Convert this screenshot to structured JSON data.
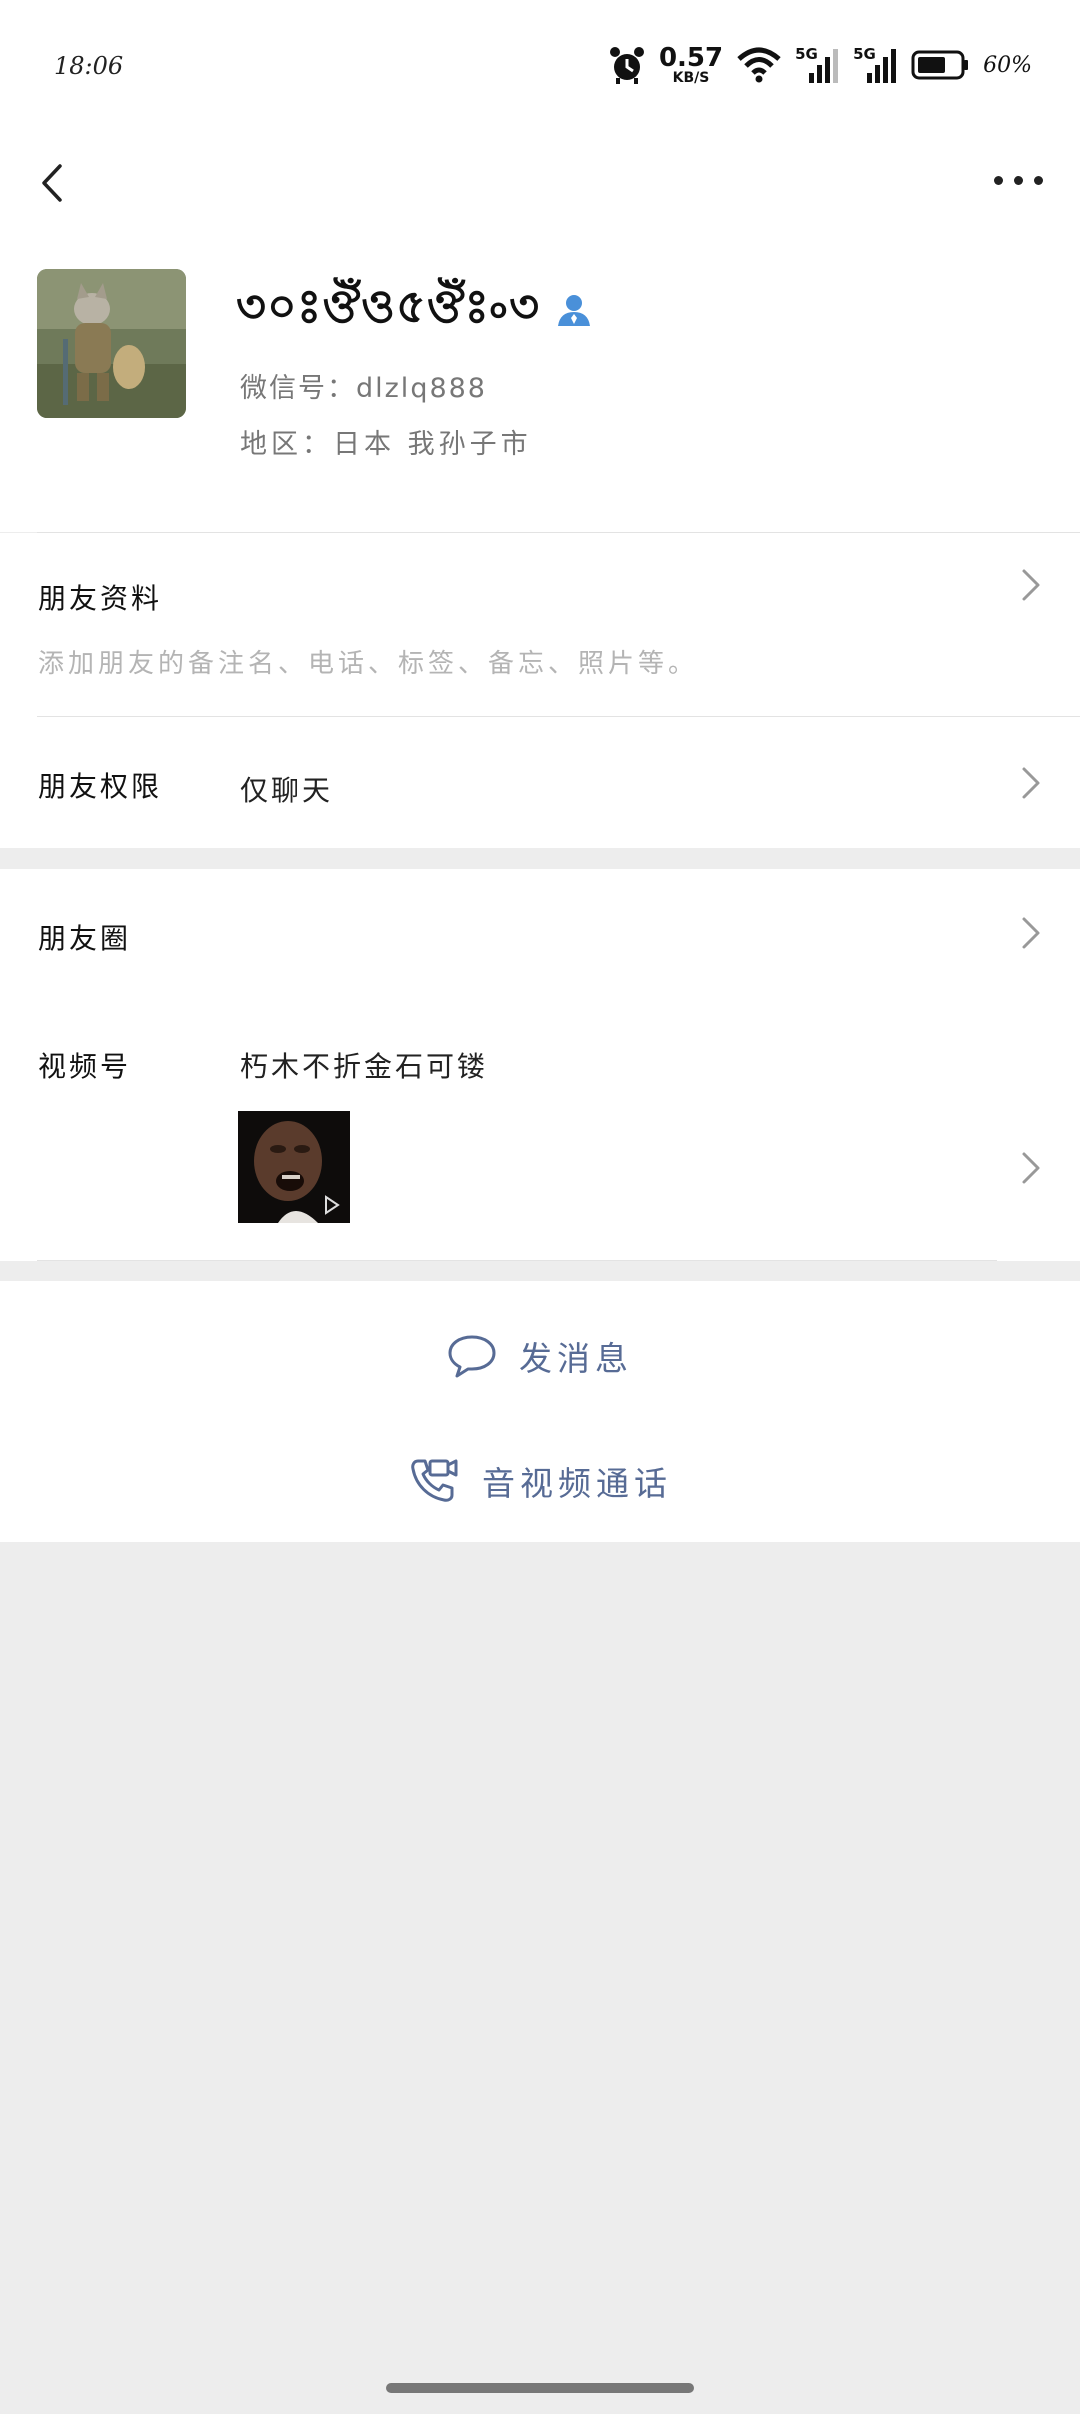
{
  "status_bar": {
    "time": "18:06",
    "net_speed_value": "0.57",
    "net_speed_unit": "KB/S",
    "sim1": "5G",
    "sim2": "5G",
    "battery": "60%"
  },
  "profile": {
    "nickname": "৩০ঃঔঁও৫ঔঁঃ৹৩",
    "wechat_id": "微信号：dlzlq888",
    "region": "地区：日本 我孙子市",
    "contact_icon": "person-badge-icon"
  },
  "rows": {
    "friend_info_label": "朋友资料",
    "friend_info_hint": "添加朋友的备注名、电话、标签、备忘、照片等。",
    "permission_label": "朋友权限",
    "permission_value": "仅聊天",
    "moments_label": "朋友圈",
    "channels_label": "视频号",
    "channels_value": "朽木不折金石可镂"
  },
  "actions": {
    "message": "发消息",
    "call": "音视频通话"
  },
  "colors": {
    "link": "#576b95",
    "background": "#ededed",
    "card": "#ffffff"
  }
}
